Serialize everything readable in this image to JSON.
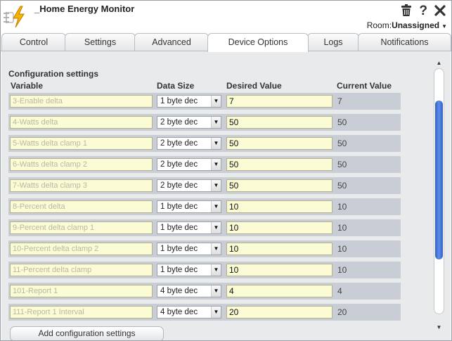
{
  "app": {
    "title": "_Home Energy Monitor",
    "icons": [
      "trash-icon",
      "help-icon",
      "close-icon"
    ],
    "room_label": "Room:",
    "room_value": "Unassigned"
  },
  "tabs": [
    {
      "label": "Control",
      "active": false
    },
    {
      "label": "Settings",
      "active": false
    },
    {
      "label": "Advanced",
      "active": false
    },
    {
      "label": "Device Options",
      "active": true
    },
    {
      "label": "Logs",
      "active": false
    },
    {
      "label": "Notifications",
      "active": false
    }
  ],
  "config": {
    "title": "Configuration settings",
    "columns": {
      "variable": "Variable",
      "data_size": "Data Size",
      "desired": "Desired Value",
      "current": "Current Value"
    },
    "rows": [
      {
        "variable": "3-Enable delta",
        "size": "1 byte dec",
        "desired": "7",
        "current": "7"
      },
      {
        "variable": "4-Watts delta",
        "size": "2 byte dec",
        "desired": "50",
        "current": "50"
      },
      {
        "variable": "5-Watts delta clamp 1",
        "size": "2 byte dec",
        "desired": "50",
        "current": "50"
      },
      {
        "variable": "6-Watts delta clamp 2",
        "size": "2 byte dec",
        "desired": "50",
        "current": "50"
      },
      {
        "variable": "7-Watts delta clamp 3",
        "size": "2 byte dec",
        "desired": "50",
        "current": "50"
      },
      {
        "variable": "8-Percent delta",
        "size": "1 byte dec",
        "desired": "10",
        "current": "10"
      },
      {
        "variable": "9-Percent delta clamp 1",
        "size": "1 byte dec",
        "desired": "10",
        "current": "10"
      },
      {
        "variable": "10-Percent delta clamp 2",
        "size": "1 byte dec",
        "desired": "10",
        "current": "10"
      },
      {
        "variable": "11-Percent delta clamp",
        "size": "1 byte dec",
        "desired": "10",
        "current": "10"
      },
      {
        "variable": "101-Report 1",
        "size": "4 byte dec",
        "desired": "4",
        "current": "4"
      },
      {
        "variable": "111-Report 1 Interval",
        "size": "4 byte dec",
        "desired": "20",
        "current": "20"
      }
    ],
    "add_button": "Add configuration settings"
  },
  "colors": {
    "row_bg": "#c9cdd6",
    "input_bg": "#fbfbd6",
    "scroll_thumb": "#3d6ed8",
    "content_bg": "#e9eaec"
  }
}
